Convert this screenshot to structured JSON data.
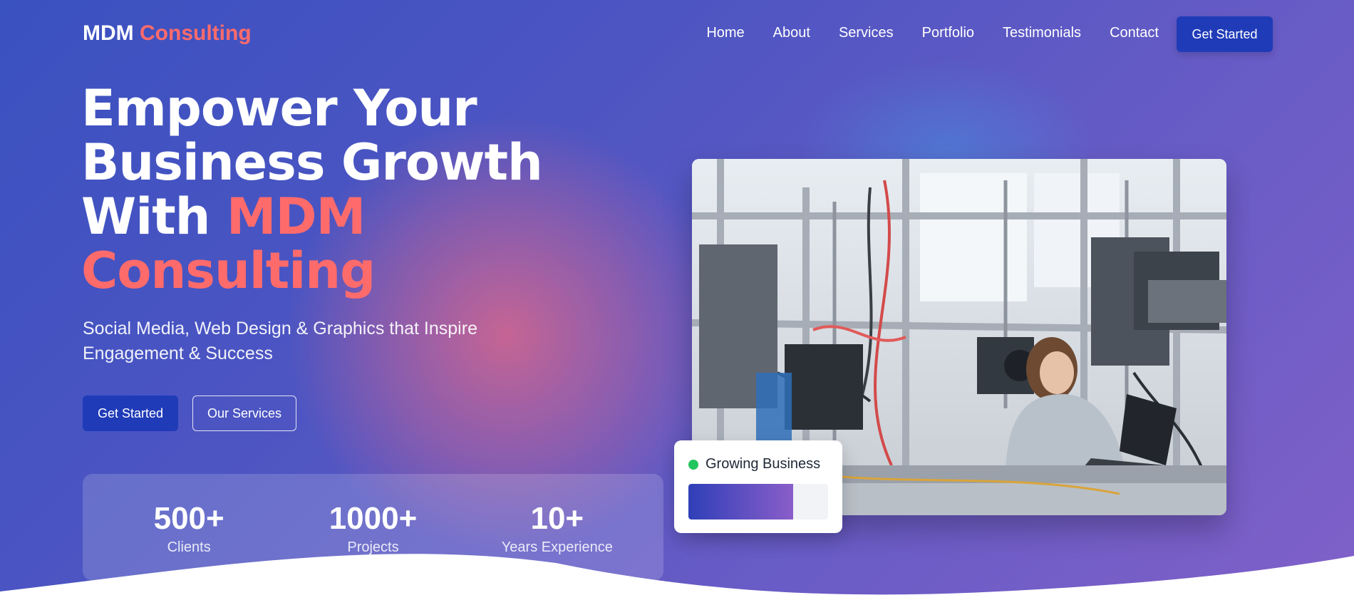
{
  "header": {
    "logo_primary": "MDM",
    "logo_accent": "Consulting",
    "nav": [
      {
        "label": "Home"
      },
      {
        "label": "About"
      },
      {
        "label": "Services"
      },
      {
        "label": "Portfolio"
      },
      {
        "label": "Testimonials"
      },
      {
        "label": "Contact"
      }
    ],
    "cta_label": "Get Started"
  },
  "hero": {
    "title_line1": "Empower Your",
    "title_line2": "Business Growth",
    "title_line3_prefix": "With",
    "title_accent_1": "MDM",
    "title_accent_2": "Consulting",
    "subtitle": "Social Media, Web Design & Graphics that Inspire Engagement & Success",
    "primary_button": "Get Started",
    "secondary_button": "Our Services"
  },
  "stats": [
    {
      "value": "500+",
      "label": "Clients"
    },
    {
      "value": "1000+",
      "label": "Projects"
    },
    {
      "value": "10+",
      "label": "Years Experience"
    }
  ],
  "floating_card": {
    "label": "Growing Business",
    "status_color": "#22c55e",
    "progress_fraction": 0.75
  },
  "colors": {
    "accent": "#ff6b6b",
    "primary_button": "#1f3bb8",
    "gradient_start": "#3a51c0",
    "gradient_end": "#8060c8"
  }
}
